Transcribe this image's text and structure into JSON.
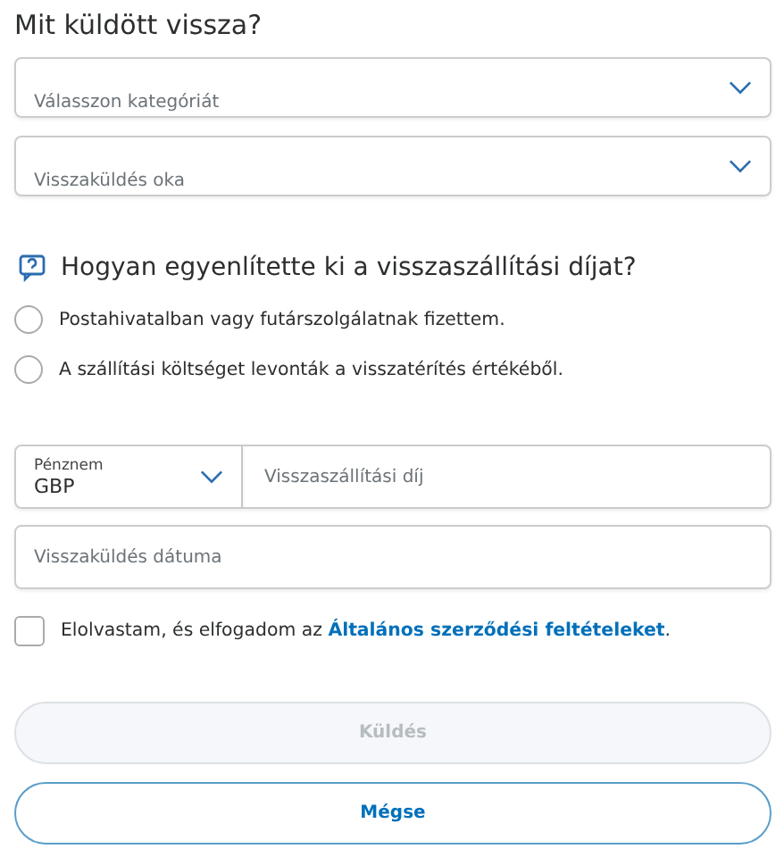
{
  "return_section": {
    "title": "Mit küldött vissza?",
    "selects": [
      {
        "placeholder": "Válasszon kategóriát"
      },
      {
        "placeholder": "Visszaküldés oka"
      }
    ]
  },
  "shipping_fee": {
    "question": "Hogyan egyenlítette ki a visszaszállítási díjat?",
    "options": [
      {
        "label": "Postahivatalban vagy futárszolgálatnak fizettem.",
        "selected": false
      },
      {
        "label": "A szállítási költséget levonták a visszatérítés értékéből.",
        "selected": false
      }
    ],
    "currency": {
      "label": "Pénznem",
      "value": "GBP"
    },
    "amount": {
      "placeholder": "Visszaszállítási díj"
    },
    "date": {
      "placeholder": "Visszaküldés dátuma"
    }
  },
  "terms": {
    "checked": false,
    "text_before": "Elolvastam, és elfogadom az ",
    "link": "Általános szerződési feltételeket",
    "text_after": "."
  },
  "buttons": [
    {
      "label": "Küldés",
      "kind": "primary",
      "disabled": true
    },
    {
      "label": "Mégse",
      "kind": "secondary",
      "disabled": false
    }
  ]
}
